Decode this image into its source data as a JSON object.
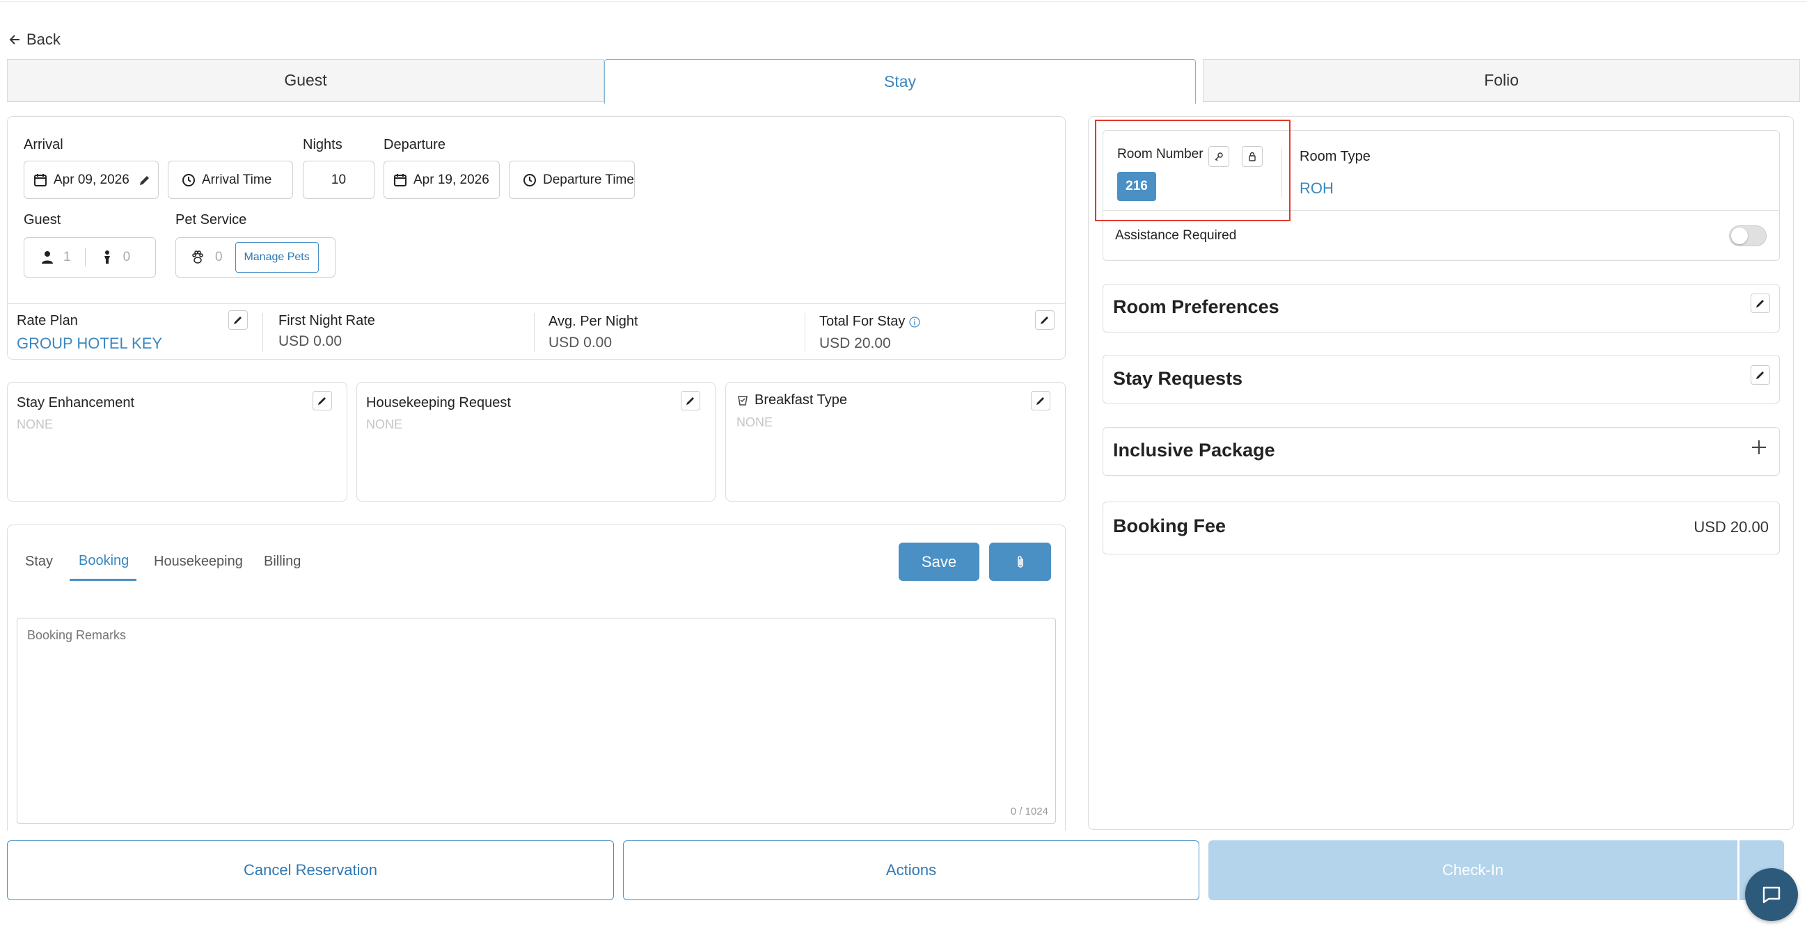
{
  "nav": {
    "back_label": "Back"
  },
  "tabs": [
    {
      "label": "Guest",
      "active": false
    },
    {
      "label": "Stay",
      "active": true
    },
    {
      "label": "Folio",
      "active": false
    }
  ],
  "stay": {
    "arrival_label": "Arrival",
    "arrival_date": "Apr 09, 2026",
    "arrival_time_placeholder": "Arrival Time",
    "nights_label": "Nights",
    "nights_value": "10",
    "departure_label": "Departure",
    "departure_date": "Apr 19, 2026",
    "departure_time_placeholder": "Departure Time",
    "guest_label": "Guest",
    "adults": "1",
    "children": "0",
    "pet_label": "Pet Service",
    "pets": "0",
    "manage_pets": "Manage Pets"
  },
  "rates": {
    "rate_plan_label": "Rate Plan",
    "rate_plan_value": "GROUP HOTEL KEY",
    "first_night_label": "First Night Rate",
    "first_night_value": "USD 0.00",
    "avg_label": "Avg. Per Night",
    "avg_value": "USD 0.00",
    "total_label": "Total For Stay",
    "total_value": "USD 20.00"
  },
  "requests": {
    "enhancement_label": "Stay Enhancement",
    "enhancement_value": "NONE",
    "housekeeping_label": "Housekeeping Request",
    "housekeeping_value": "NONE",
    "breakfast_label": "Breakfast Type",
    "breakfast_value": "NONE"
  },
  "remarks": {
    "tabs": [
      "Stay",
      "Booking",
      "Housekeeping",
      "Billing"
    ],
    "active_tab": "Booking",
    "save_label": "Save",
    "placeholder": "Booking Remarks",
    "counter": "0 / 1024"
  },
  "room": {
    "number_label": "Room Number",
    "number_value": "216",
    "type_label": "Room Type",
    "type_value": "ROH",
    "assistance_label": "Assistance Required",
    "assistance_on": false
  },
  "sections": {
    "preferences": "Room Preferences",
    "stay_requests": "Stay Requests",
    "inclusive": "Inclusive Package",
    "booking_fee": "Booking Fee",
    "booking_fee_value": "USD 20.00"
  },
  "footer": {
    "cancel": "Cancel Reservation",
    "actions": "Actions",
    "checkin": "Check-In"
  },
  "colors": {
    "accent": "#4a90c5",
    "highlight": "#e0392b",
    "disabled": "#b3d4ea"
  }
}
